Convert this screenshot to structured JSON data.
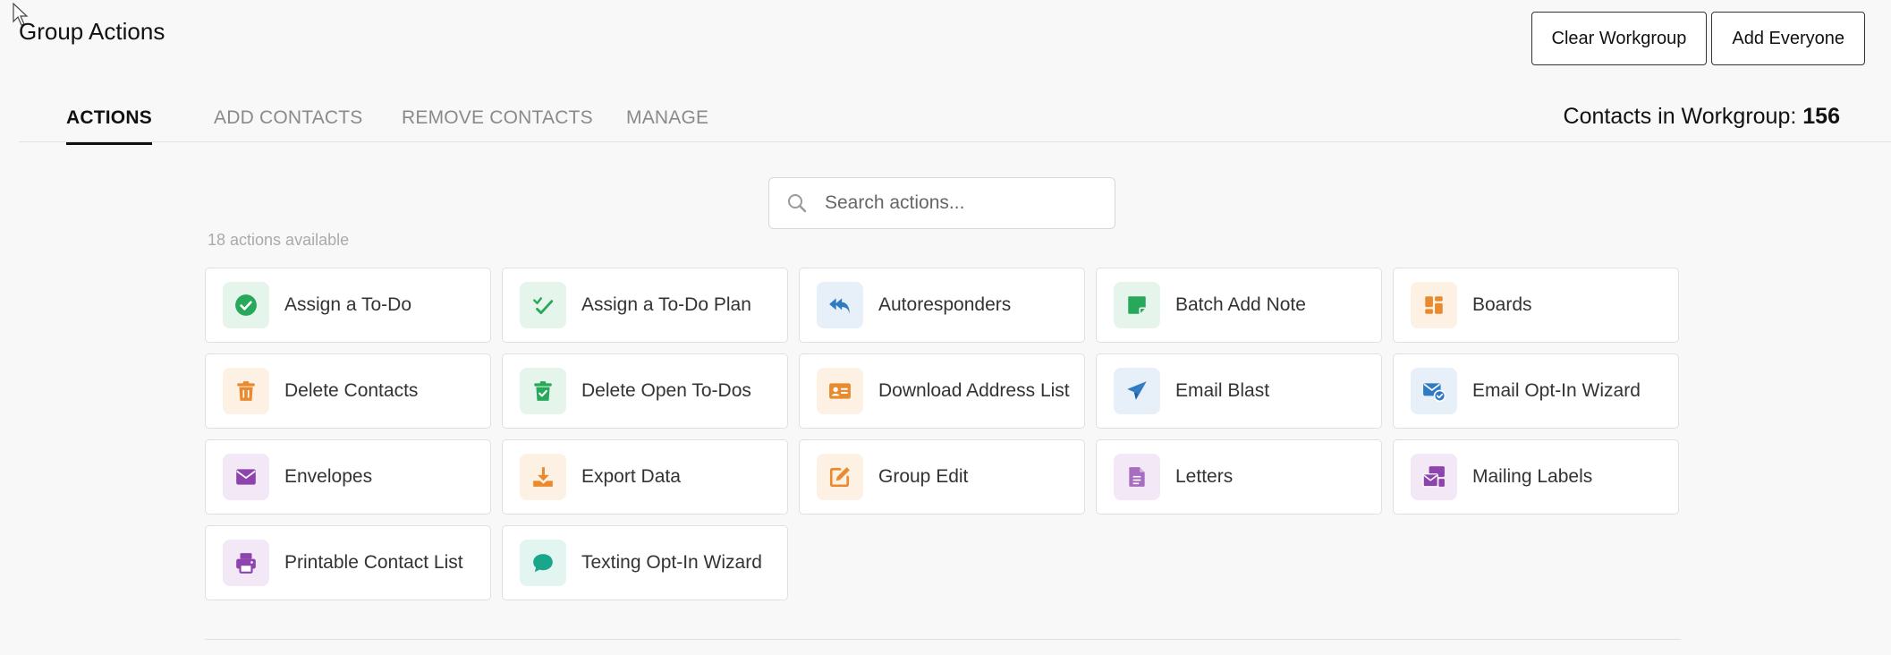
{
  "header": {
    "title": "Group Actions",
    "buttons": {
      "clear": "Clear Workgroup",
      "add": "Add Everyone"
    }
  },
  "tabs": [
    {
      "label": "ACTIONS",
      "active": true
    },
    {
      "label": "ADD CONTACTS"
    },
    {
      "label": "REMOVE CONTACTS"
    },
    {
      "label": "MANAGE"
    }
  ],
  "contacts": {
    "label": "Contacts in Workgroup:",
    "count": "156"
  },
  "search": {
    "placeholder": "Search actions..."
  },
  "available_text": "18 actions available",
  "colors": {
    "green": "#27a85a",
    "green_bg": "#e6f5ec",
    "blue": "#2f7bc2",
    "blue_bg": "#e7eff8",
    "orange": "#e98a2f",
    "orange_bg": "#fdf1e4",
    "purple": "#8e44ad",
    "purple_bg": "#f2e8f6",
    "teal": "#1aa68a",
    "teal_bg": "#e3f5f1"
  },
  "actions": [
    {
      "label": "Assign a To-Do",
      "icon": "check-circle-icon",
      "color": "green"
    },
    {
      "label": "Assign a To-Do Plan",
      "icon": "checks-icon",
      "color": "green"
    },
    {
      "label": "Autoresponders",
      "icon": "reply-all-icon",
      "color": "blue"
    },
    {
      "label": "Batch Add Note",
      "icon": "sticky-note-icon",
      "color": "green"
    },
    {
      "label": "Boards",
      "icon": "boards-icon",
      "color": "orange"
    },
    {
      "label": "Delete Contacts",
      "icon": "trash-icon",
      "color": "orange"
    },
    {
      "label": "Delete Open To-Dos",
      "icon": "trash-check-icon",
      "color": "green"
    },
    {
      "label": "Download Address List",
      "icon": "address-card-icon",
      "color": "orange"
    },
    {
      "label": "Email Blast",
      "icon": "paper-plane-icon",
      "color": "blue"
    },
    {
      "label": "Email Opt-In Wizard",
      "icon": "envelope-check-icon",
      "color": "blue"
    },
    {
      "label": "Envelopes",
      "icon": "envelope-icon",
      "color": "purple"
    },
    {
      "label": "Export Data",
      "icon": "download-icon",
      "color": "orange"
    },
    {
      "label": "Group Edit",
      "icon": "edit-icon",
      "color": "orange"
    },
    {
      "label": "Letters",
      "icon": "file-text-icon",
      "color": "purple"
    },
    {
      "label": "Mailing Labels",
      "icon": "mail-bulk-icon",
      "color": "purple"
    },
    {
      "label": "Printable Contact List",
      "icon": "print-icon",
      "color": "purple"
    },
    {
      "label": "Texting Opt-In Wizard",
      "icon": "comment-icon",
      "color": "teal"
    }
  ]
}
